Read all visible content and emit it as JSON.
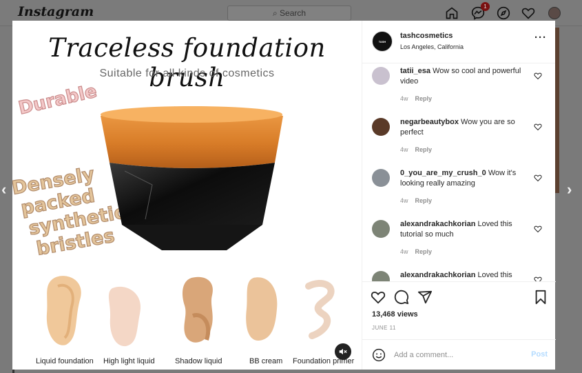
{
  "app": {
    "logo": "Instagram",
    "search_placeholder": "Search",
    "notif_count": "1"
  },
  "post": {
    "account": "tashcosmetics",
    "location": "Los Angeles, California",
    "views": "13,468 views",
    "date": "JUNE 11",
    "comment_placeholder": "Add a comment...",
    "post_label": "Post"
  },
  "media": {
    "title": "Traceless foundation brush",
    "subtitle": "Suitable for all kinds of cosmetics",
    "sticker_1": "Durable",
    "sticker_2_l1": "Densely",
    "sticker_2_l2": "packed",
    "sticker_2_l3": "synthetic",
    "sticker_2_l4": "bristles",
    "labels": [
      "Liquid foundation",
      "High light liquid",
      "Shadow liquid",
      "BB cream",
      "Foundation primer"
    ]
  },
  "comments": [
    {
      "user": "tatii_esa",
      "text": "Wow so cool and powerful video",
      "age": "4w",
      "reply": "Reply",
      "avatar_color": "#c9c1cf"
    },
    {
      "user": "negarbeautybox",
      "text": "Wow you are so perfect",
      "age": "4w",
      "reply": "Reply",
      "avatar_color": "#5a3a28"
    },
    {
      "user": "0_you_are_my_crush_0",
      "text": "Wow it's looking really amazing",
      "age": "4w",
      "reply": "Reply",
      "avatar_color": "#8a9097"
    },
    {
      "user": "alexandrakachkorian",
      "text": "Loved this tutorial so much",
      "age": "4w",
      "reply": "Reply",
      "avatar_color": "#7d8476"
    },
    {
      "user": "alexandrakachkorian",
      "text": "Loved this",
      "age": "",
      "reply": "",
      "avatar_color": "#7d8476"
    }
  ],
  "icons": [
    "home-icon",
    "messenger-icon",
    "explore-icon",
    "heart-icon",
    "comment-icon",
    "share-icon",
    "bookmark-icon",
    "emoji-icon",
    "mute-icon",
    "more-icon"
  ]
}
